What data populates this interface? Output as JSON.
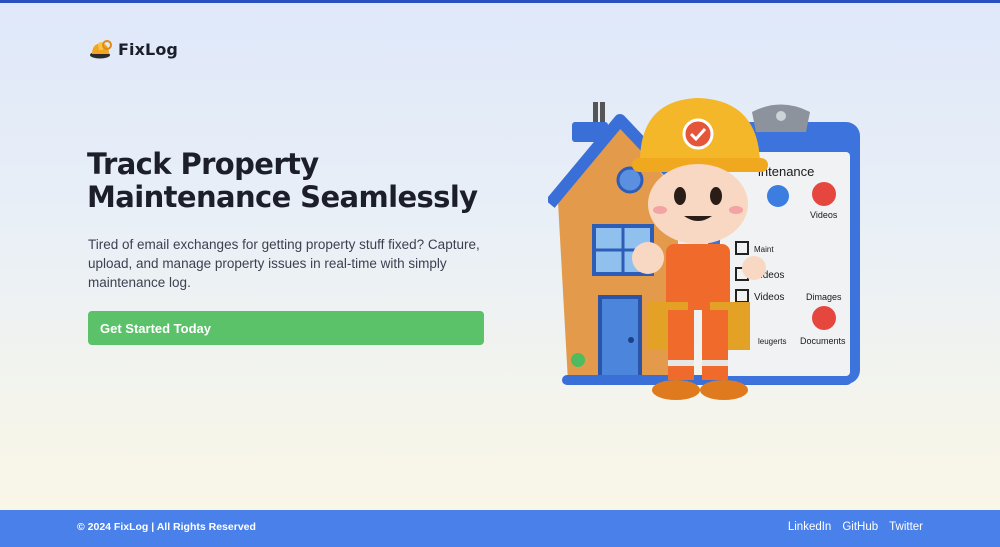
{
  "brand": {
    "name": "FixLog",
    "logo_icon": "hardhat-wrench-icon"
  },
  "hero": {
    "title_line1": "Track Property",
    "title_line2": "Maintenance Seamlessly",
    "description": "Tired of email exchanges for getting property stuff fixed? Capture, upload, and manage property issues in real-time with simply maintenance log.",
    "cta_label": "Get Started Today"
  },
  "illustration": {
    "clipboard_title": "intenance",
    "rows": [
      "Videos",
      "Maint",
      "Videos",
      "Videos",
      "Dimages",
      "leugerts",
      "Documents"
    ]
  },
  "footer": {
    "copyright": "© 2024 FixLog | All Rights Reserved",
    "links": [
      "LinkedIn",
      "GitHub",
      "Twitter"
    ]
  },
  "colors": {
    "accent_green": "#5bc26a",
    "footer_blue": "#4a80ea",
    "text_dark": "#1c1f2a"
  }
}
